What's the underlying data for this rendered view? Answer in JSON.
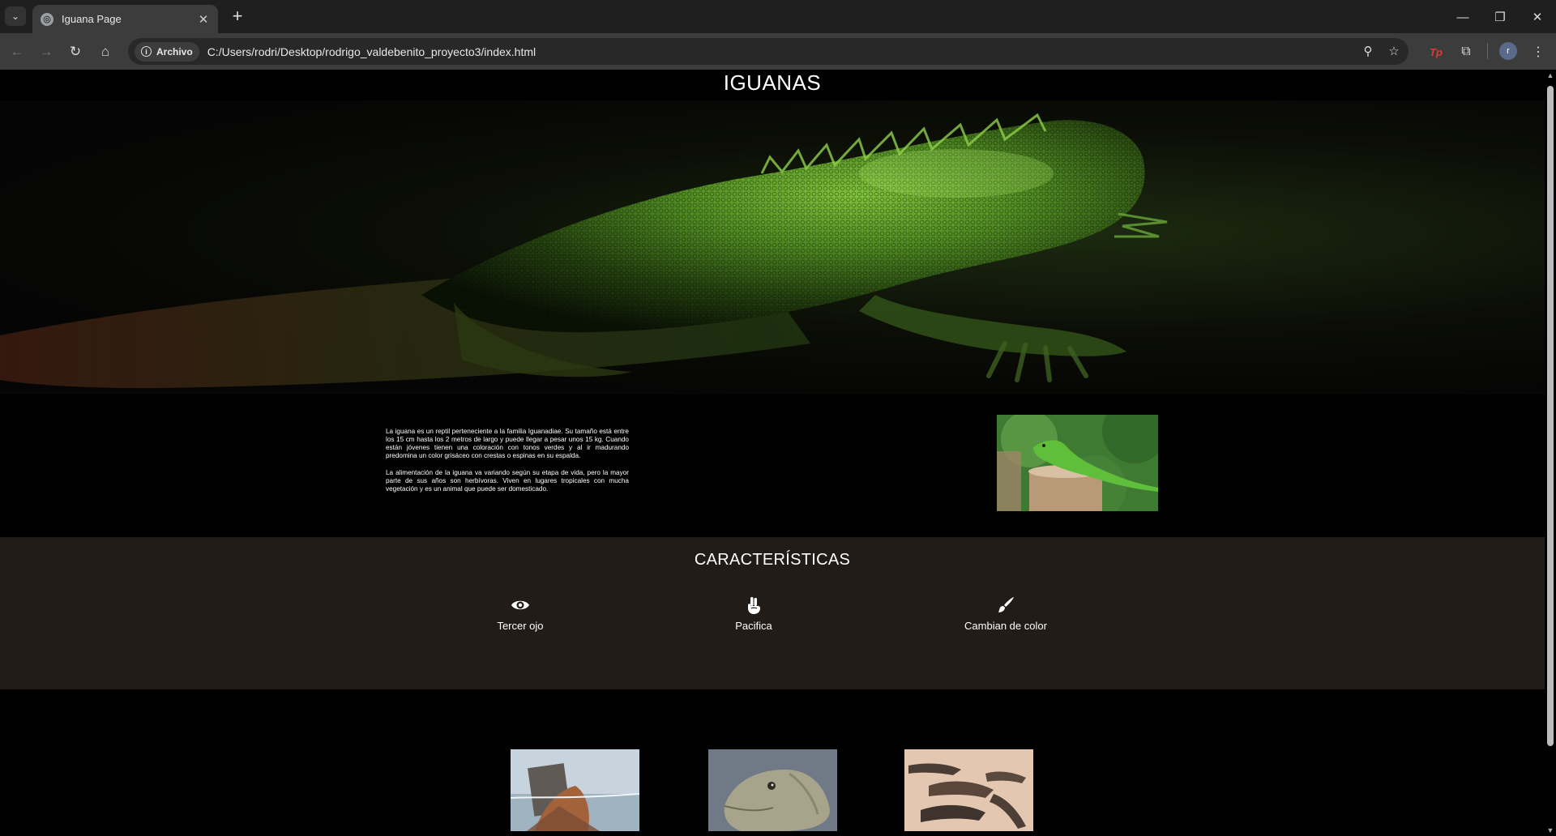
{
  "browser": {
    "tab_title": "Iguana Page",
    "new_tab_label": "+",
    "security_chip_label": "Archivo",
    "url": "C:/Users/rodri/Desktop/rodrigo_valdebenito_proyecto3/index.html",
    "profile_initial": "r",
    "extension_label": "Tp"
  },
  "page": {
    "title": "IGUANAS",
    "intro": {
      "paragraph1": "La iguana es un reptil perteneciente a la familia Iguanadiae. Su tamaño está entre los 15 cm hasta los 2 metros de largo y puede llegar a pesar unos 15 kg. Cuando están jóvenes tienen una coloración con tonos verdes y al ir madurando predomina un color grisáceo con crestas o espinas en su espalda.",
      "paragraph2": "La alimentación de la iguana va variando según su etapa de vida, pero la mayor parte de sus años son herbívoras. Viven en lugares tropicales con mucha vegetación y es un animal que puede ser domesticado."
    },
    "features": {
      "title": "CARACTERÍSTICAS",
      "items": [
        {
          "label": "Tercer ojo",
          "icon": "eye-icon"
        },
        {
          "label": "Pacifica",
          "icon": "peace-hand-icon"
        },
        {
          "label": "Cambian de color",
          "icon": "paintbrush-icon"
        }
      ]
    },
    "colors": {
      "page_background": "#000000",
      "features_background": "#211c18",
      "text": "#ffffff"
    }
  }
}
